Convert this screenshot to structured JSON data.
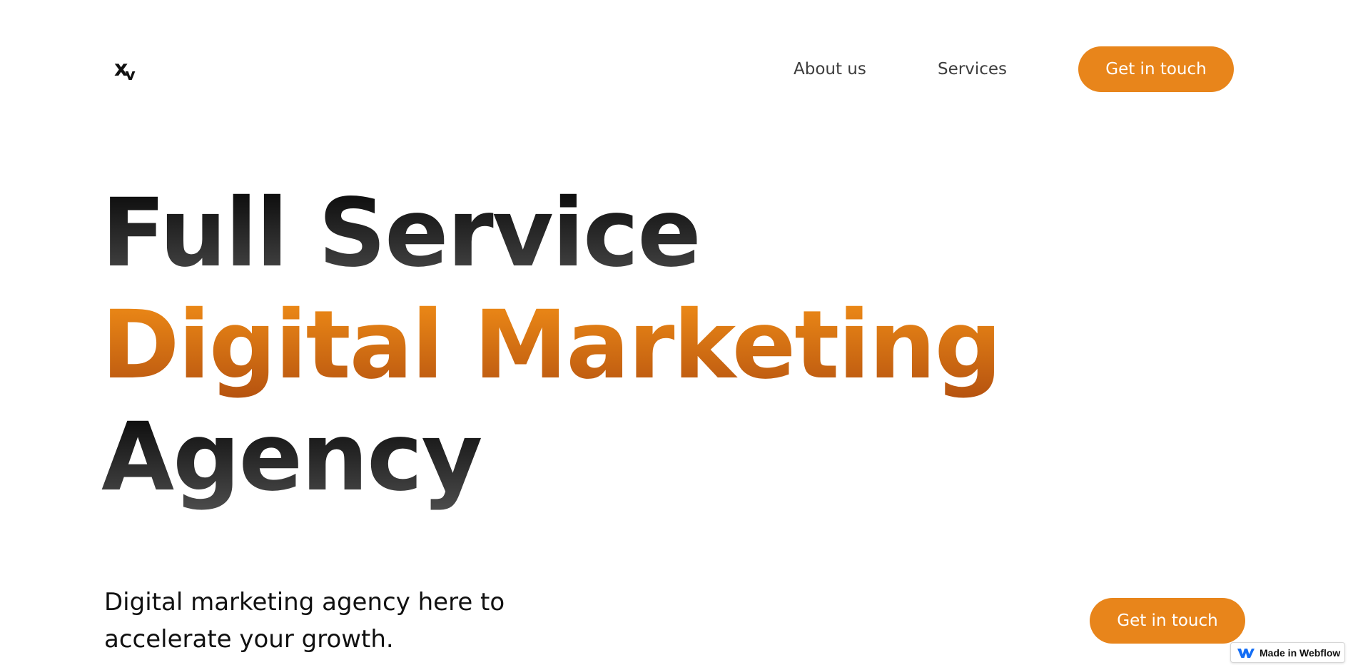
{
  "nav": {
    "logo": {
      "x": "x",
      "v": "v"
    },
    "links": [
      {
        "label": "About us"
      },
      {
        "label": "Services"
      }
    ],
    "cta_label": "Get in touch"
  },
  "hero": {
    "line_1": "Full Service",
    "line_2": "Digital Marketing",
    "line_3": "Agency",
    "subtitle_line_1": "Digital marketing agency here to",
    "subtitle_line_2": "accelerate your growth.",
    "cta_label": "Get in touch"
  },
  "badge": {
    "label": "Made in Webflow",
    "icon": "webflow-icon"
  },
  "colors": {
    "accent": "#e8851b",
    "accent_gradient_top": "#ea8716",
    "accent_gradient_bottom": "#b75410",
    "text_dark": "#111111",
    "nav_text": "#3d3d3d",
    "webflow_blue": "#146ef5"
  }
}
